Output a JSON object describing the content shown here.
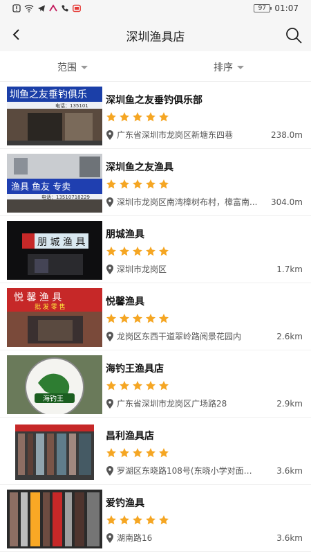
{
  "status_bar": {
    "battery": "97",
    "time": "01:07"
  },
  "header": {
    "title": "深圳渔具店"
  },
  "filters": {
    "range_label": "范围",
    "sort_label": "排序"
  },
  "colors": {
    "star": "#F5A623",
    "background": "#ffffff",
    "header_bg": "#f6f6f6"
  },
  "stores": [
    {
      "name": "深圳鱼之友垂钓俱乐部",
      "rating": 5,
      "address": "广东省深圳市龙岗区新塘东四巷",
      "distance": "238.0m",
      "sign_text": "圳鱼之友垂钓俱乐",
      "sign_sub": "电话：135101"
    },
    {
      "name": "深圳鱼之友渔具",
      "rating": 5,
      "address": "深圳市龙岗区南湾樟树布村，樟富南...",
      "distance": "304.0m",
      "sign_text": "渔具 鱼友 专卖",
      "sign_sub": "电话：13510718229"
    },
    {
      "name": "朋城渔具",
      "rating": 5,
      "address": "深圳市龙岗区",
      "distance": "1.7km",
      "sign_text": "朋 城 渔 具",
      "sign_sub": ""
    },
    {
      "name": "悦馨渔具",
      "rating": 5,
      "address": "龙岗区东西干道翠岭路阅景花园内",
      "distance": "2.6km",
      "sign_text": "悦 馨 渔 具",
      "sign_sub": "批 发  零 售"
    },
    {
      "name": "海钓王渔具店",
      "rating": 5,
      "address": "广东省深圳市龙岗区广场路28",
      "distance": "2.9km",
      "sign_text": "海钓王",
      "sign_sub": ""
    },
    {
      "name": "昌利渔具店",
      "rating": 5,
      "address": "罗湖区东晓路108号(东晓小学对面停...",
      "distance": "3.6km",
      "sign_text": "",
      "sign_sub": ""
    },
    {
      "name": "爱钓渔具",
      "rating": 5,
      "address": "湖南路16",
      "distance": "3.6km",
      "sign_text": "",
      "sign_sub": ""
    }
  ]
}
